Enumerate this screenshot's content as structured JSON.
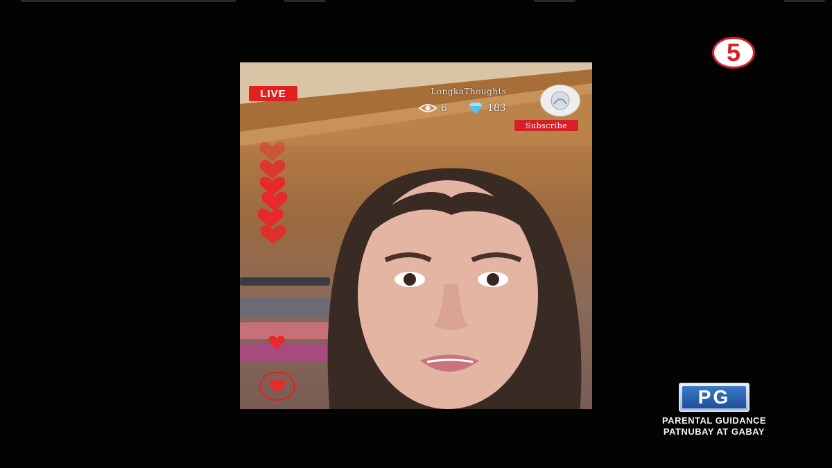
{
  "channel": {
    "logo_text": "5",
    "color": "#d61f26"
  },
  "stream": {
    "live_label": "LIVE",
    "username": "LongkaThoughts",
    "viewer_count": "6",
    "diamond_count": "183",
    "subscribe_label": "Subscribe",
    "icons": {
      "viewers": "eye-icon",
      "diamonds": "diamond-icon",
      "like": "heart-icon"
    },
    "accent": "#e3201e"
  },
  "rating": {
    "code": "PG",
    "line1": "PARENTAL GUIDANCE",
    "line2": "PATNUBAY AT GABAY"
  }
}
